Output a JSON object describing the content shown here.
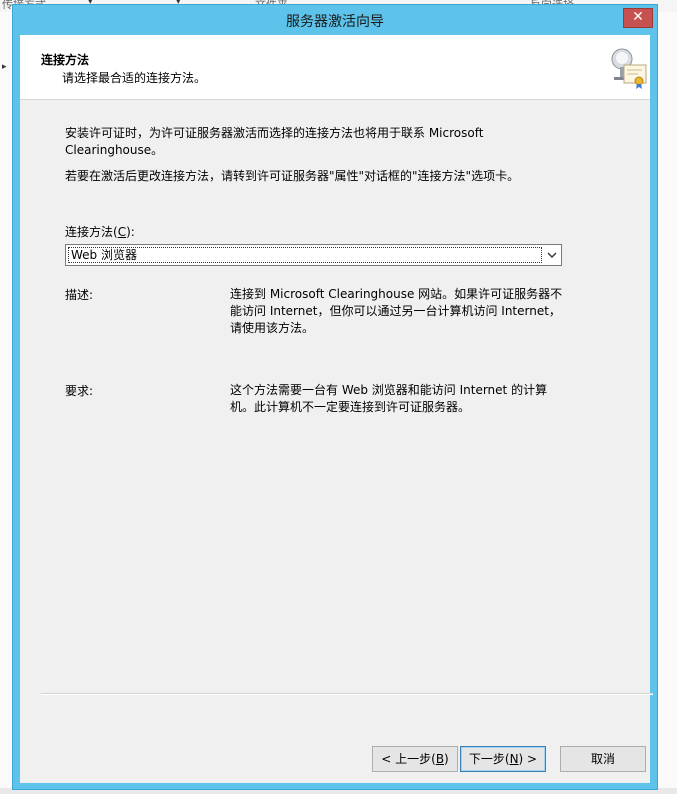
{
  "background": {
    "fragments": [
      "传接方式",
      "文件夹",
      "反向选择"
    ]
  },
  "window": {
    "title": "服务器激活向导",
    "close_label": "✕"
  },
  "header": {
    "title": "连接方法",
    "subtitle": "请选择最合适的连接方法。",
    "icon": "server-certificate-icon"
  },
  "intro": {
    "line1": "安装许可证时，为许可证服务器激活而选择的连接方法也将用于联系 Microsoft",
    "line2": "Clearinghouse。",
    "line3": "若要在激活后更改连接方法，请转到许可证服务器\"属性\"对话框的\"连接方法\"选项卡。"
  },
  "connection": {
    "label_prefix": "连接方法(",
    "label_key": "C",
    "label_suffix": "):",
    "selected": "Web 浏览器"
  },
  "description": {
    "label": "描述:",
    "line1": "连接到 Microsoft Clearinghouse 网站。如果许可证服务器不",
    "line2": "能访问 Internet，但你可以通过另一台计算机访问 Internet，",
    "line3": "请使用该方法。"
  },
  "requirements": {
    "label": "要求:",
    "line1": "这个方法需要一台有 Web 浏览器和能访问 Internet 的计算",
    "line2": "机。此计算机不一定要连接到许可证服务器。"
  },
  "buttons": {
    "back_prefix": "< 上一步(",
    "back_key": "B",
    "back_suffix": ")",
    "next_prefix": "下一步(",
    "next_key": "N",
    "next_suffix": ") >",
    "cancel": "取消"
  }
}
